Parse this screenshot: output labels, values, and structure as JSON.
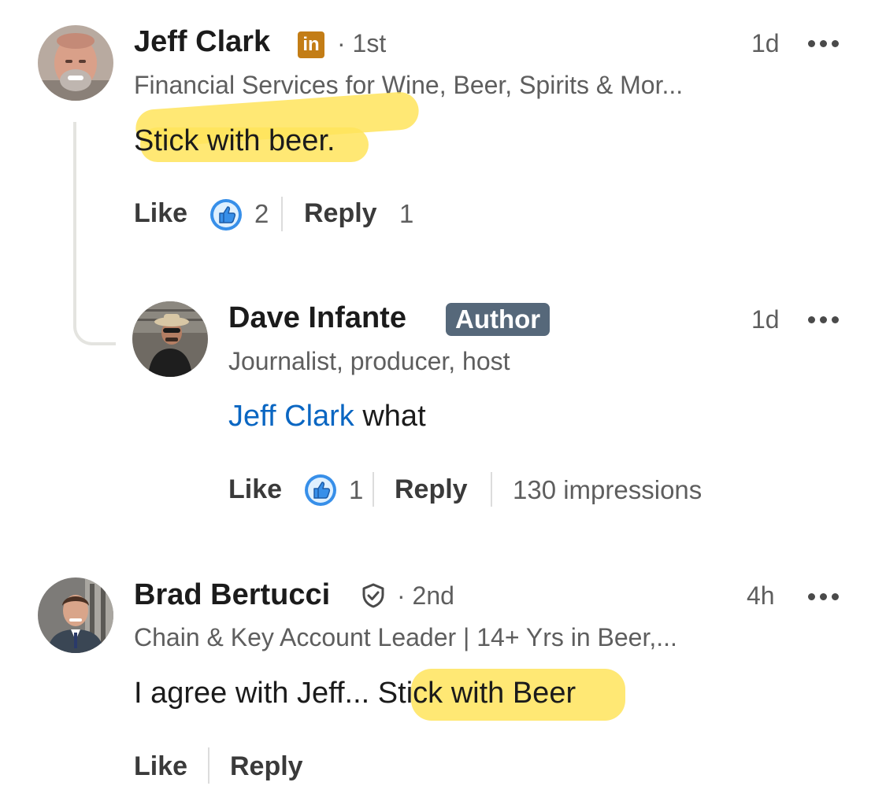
{
  "comments": [
    {
      "name": "Jeff Clark",
      "degree": "1st",
      "headline": "Financial Services for Wine, Beer, Spirits & Mor...",
      "time": "1d",
      "text": "Stick with beer.",
      "like_label": "Like",
      "like_count": "2",
      "reply_label": "Reply",
      "reply_count": "1"
    },
    {
      "name": "Dave Infante",
      "badge": "Author",
      "headline": "Journalist, producer, host",
      "time": "1d",
      "mention": "Jeff Clark",
      "text": "what",
      "like_label": "Like",
      "like_count": "1",
      "reply_label": "Reply",
      "impressions": "130 impressions"
    },
    {
      "name": "Brad Bertucci",
      "degree": "2nd",
      "headline": "Chain & Key Account Leader | 14+ Yrs in Beer,...",
      "time": "4h",
      "text_pre": "I agree with Jeff... ",
      "text_highlight": "Stick with Beer",
      "like_label": "Like",
      "reply_label": "Reply"
    }
  ],
  "icons": {
    "linkedin_badge": "in",
    "reaction": "thumbs-up-icon",
    "verified": "shield-check-icon",
    "more": "more-options-icon"
  },
  "colors": {
    "highlight": "#ffe45c",
    "mention": "#0a66c2",
    "author_badge": "#56687a",
    "linkedin_badge": "#c37d16",
    "reaction_blue": "#378fe9"
  }
}
